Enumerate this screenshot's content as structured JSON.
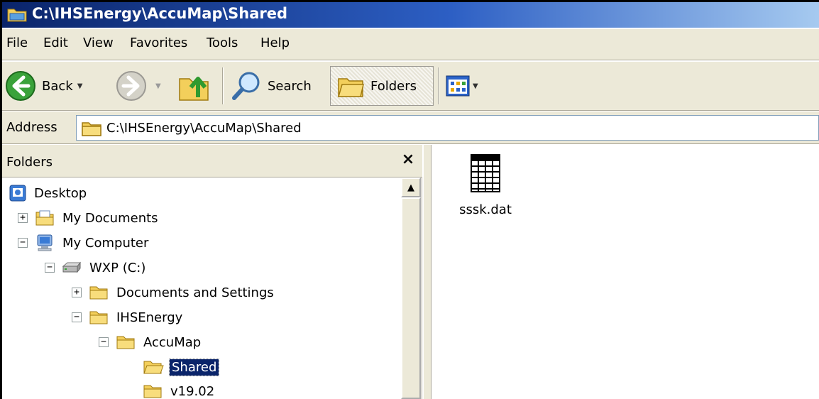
{
  "window": {
    "title": "C:\\IHSEnergy\\AccuMap\\Shared"
  },
  "menu": [
    "File",
    "Edit",
    "View",
    "Favorites",
    "Tools",
    "Help"
  ],
  "toolbar": {
    "back": "Back",
    "search": "Search",
    "folders": "Folders"
  },
  "address": {
    "label": "Address",
    "value": "C:\\IHSEnergy\\AccuMap\\Shared"
  },
  "folders_pane": {
    "title": "Folders",
    "close": "×",
    "tree": [
      {
        "label": "Desktop",
        "icon": "desktop-icon",
        "expander": ""
      },
      {
        "label": "My Documents",
        "icon": "my-documents-icon",
        "expander": "+"
      },
      {
        "label": "My Computer",
        "icon": "my-computer-icon",
        "expander": "−"
      },
      {
        "label": "WXP (C:)",
        "icon": "drive-icon",
        "expander": "−"
      },
      {
        "label": "Documents and Settings",
        "icon": "folder-icon",
        "expander": "+"
      },
      {
        "label": "IHSEnergy",
        "icon": "folder-icon",
        "expander": "−"
      },
      {
        "label": "AccuMap",
        "icon": "folder-icon",
        "expander": "−"
      },
      {
        "label": "Shared",
        "icon": "open-folder-icon",
        "expander": "",
        "selected": true
      },
      {
        "label": "v19.02",
        "icon": "folder-icon",
        "expander": ""
      }
    ]
  },
  "content": {
    "files": [
      {
        "name": "sssk.dat",
        "icon": "data-file-icon"
      }
    ]
  },
  "colors": {
    "titlebar": "#0a246a",
    "selection": "#0a246a",
    "chrome": "#ece9d8"
  }
}
